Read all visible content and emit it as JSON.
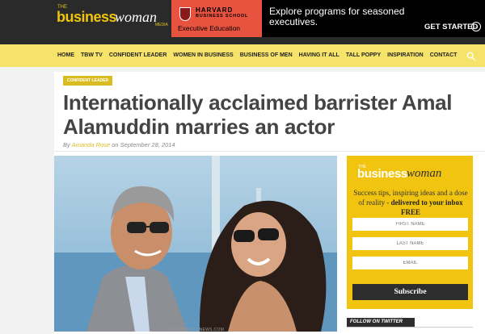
{
  "header": {
    "logo": {
      "the": "THE",
      "business": "business",
      "woman": "woman",
      "media": "MEDIA"
    },
    "ad": {
      "school": "HARVARD",
      "school_sub": "BUSINESS SCHOOL",
      "program": "Executive Education",
      "headline": "Explore programs for seasoned executives.",
      "cta": "GET STARTED",
      "cta_icon": "arrow-right-circle-icon",
      "color_red": "#e8533f"
    }
  },
  "nav": {
    "items": [
      "HOME",
      "TBW TV",
      "CONFIDENT LEADER",
      "WOMEN IN BUSINESS",
      "BUSINESS OF MEN",
      "HAVING IT ALL",
      "TALL POPPY",
      "INSPIRATION",
      "CONTACT"
    ],
    "search_icon": "search-icon",
    "bg": "#f5e36a"
  },
  "article": {
    "category": "CONFIDENT LEADER",
    "title": "Internationally acclaimed barrister Amal Alamuddin marries an actor",
    "by": "By",
    "author": "Amanda Rose",
    "on": "on",
    "date": "September 28, 2014",
    "photo_credit": "WWW.NYDAILYNEWS.COM",
    "accent": "#d9bc22"
  },
  "sidebar": {
    "signup": {
      "logo_the": "THE",
      "logo_business": "business",
      "logo_woman": "woman",
      "tagline_plain": "Success tips, inspiring ideas and a dose of reality -",
      "tagline_bold": "delivered to your inbox FREE",
      "first_name": "FIRST NAME",
      "last_name": "LAST NAME",
      "email": "EMAIL",
      "subscribe": "Subscribe",
      "bg": "#f1c40f"
    },
    "follow": "FOLLOW ON TWITTER"
  }
}
